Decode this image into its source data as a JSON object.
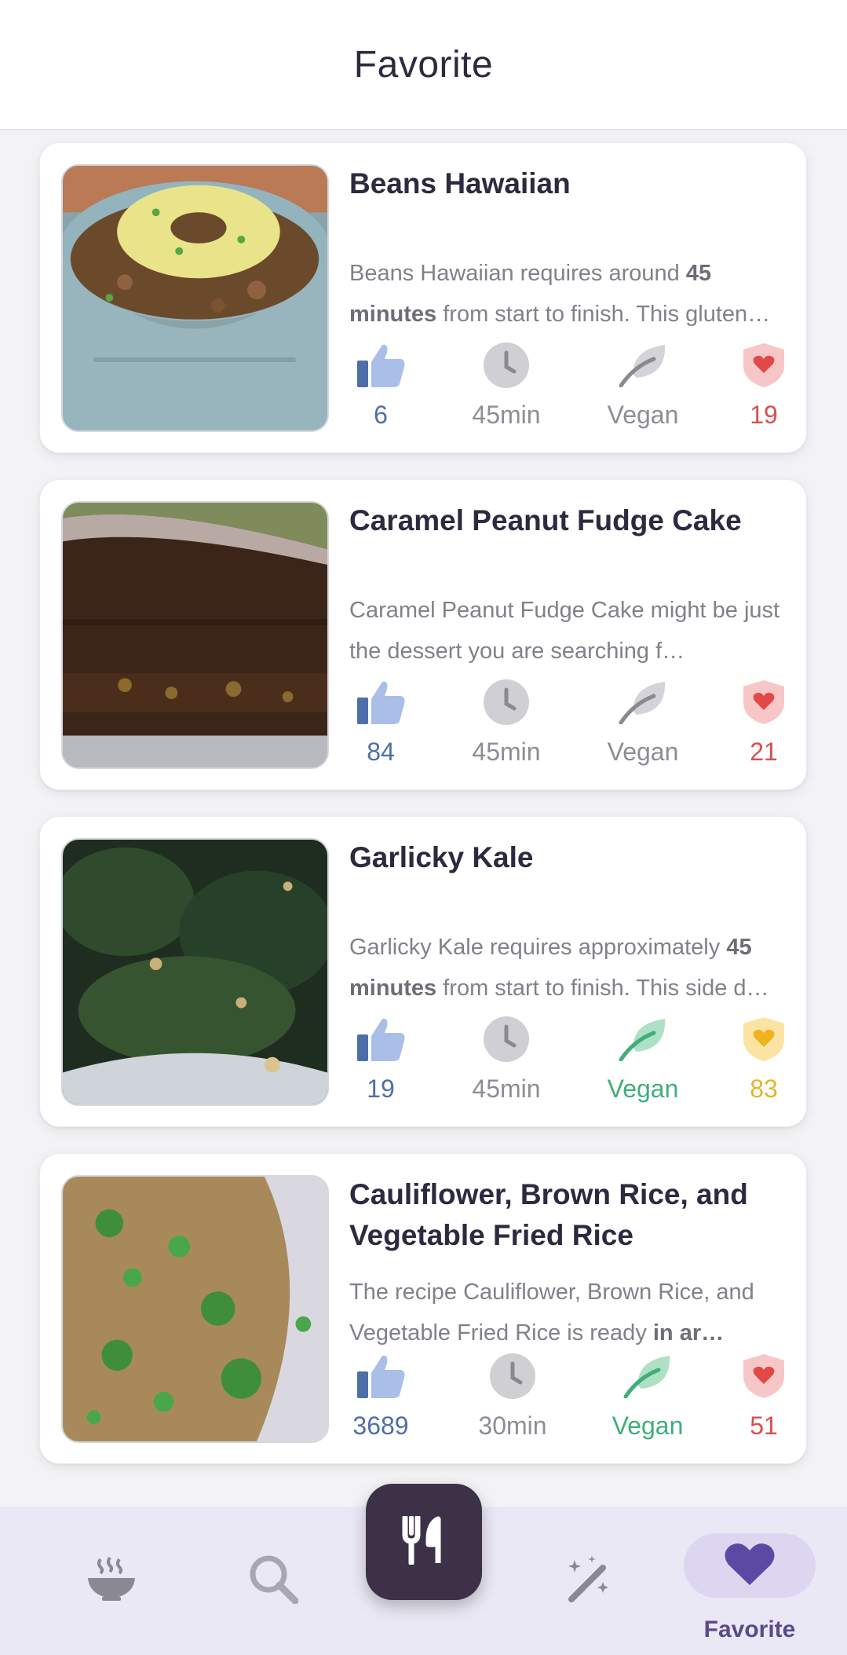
{
  "header": {
    "title": "Favorite"
  },
  "cards": [
    {
      "title": "Beans Hawaiian",
      "desc_pre": "Beans Hawaiian requires around ",
      "desc_bold": "45 minutes",
      "desc_post": " from start to finish. This gluten…",
      "likes": "6",
      "time": "45min",
      "diet": "Vegan",
      "diet_active": false,
      "health": "19",
      "health_color": "red"
    },
    {
      "title": "Caramel Peanut Fudge Cake",
      "desc_pre": "Caramel Peanut Fudge Cake might be just the dessert you are searching f…",
      "desc_bold": "",
      "desc_post": "",
      "likes": "84",
      "time": "45min",
      "diet": "Vegan",
      "diet_active": false,
      "health": "21",
      "health_color": "red"
    },
    {
      "title": "Garlicky Kale",
      "desc_pre": "Garlicky Kale requires approximately ",
      "desc_bold": "45 minutes",
      "desc_post": " from start to finish. This side d…",
      "likes": "19",
      "time": "45min",
      "diet": "Vegan",
      "diet_active": true,
      "health": "83",
      "health_color": "gold"
    },
    {
      "title": "Cauliflower, Brown Rice, and Vegetable Fried Rice",
      "desc_pre": "The recipe Cauliflower, Brown Rice, and Vegetable Fried Rice is ready ",
      "desc_bold": "in ar…",
      "desc_post": "",
      "likes": "3689",
      "time": "30min",
      "diet": "Vegan",
      "diet_active": true,
      "health": "51",
      "health_color": "red"
    }
  ],
  "tabbar": {
    "items": [
      "bowl-icon",
      "search-icon",
      "fork-knife-icon",
      "magic-wand-icon",
      "heart-icon"
    ],
    "active_label": "Favorite"
  },
  "colors": {
    "accent": "#3d3148",
    "like_blue": "#9fb6e3",
    "vegan_green": "#3fae7a",
    "health_red": "#d94f4f",
    "health_gold": "#e6b32c"
  }
}
